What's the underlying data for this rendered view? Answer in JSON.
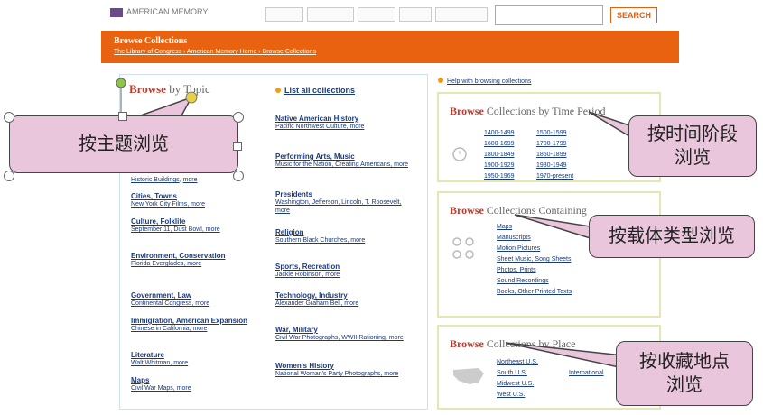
{
  "header": {
    "logo_text": "AMERICAN MEMORY",
    "search_label": "SEARCH"
  },
  "banner": {
    "title": "Browse Collections",
    "crumbs": "The Library of Congress › American Memory Home › Browse Collections"
  },
  "topic_panel": {
    "heading_bold": "Browse",
    "heading_rest": " by Topic",
    "list_all": "List all collections",
    "left_topics": [
      {
        "title": "Historic Buildings",
        "sub": "more"
      },
      {
        "title": "Cities, Towns",
        "sub": "New York City Films, more"
      },
      {
        "title": "Culture, Folklife",
        "sub": "September 11, Dust Bowl, more"
      },
      {
        "title": "Environment, Conservation",
        "sub": "Florida Everglades, more"
      },
      {
        "title": "Government, Law",
        "sub": "Continental Congress, more"
      },
      {
        "title": "Immigration, American Expansion",
        "sub": "Chinese in California, more"
      },
      {
        "title": "Literature",
        "sub": "Walt Whitman, more"
      },
      {
        "title": "Maps",
        "sub": "Civil War Maps, more"
      }
    ],
    "right_topics": [
      {
        "title": "Native American History",
        "sub": "Pacific Northwest Culture, more"
      },
      {
        "title": "Performing Arts, Music",
        "sub": "Music for the Nation, Creating Americans, more"
      },
      {
        "title": "Presidents",
        "sub": "Washington, Jefferson, Lincoln, T. Roosevelt, more"
      },
      {
        "title": "Religion",
        "sub": "Southern Black Churches, more"
      },
      {
        "title": "Sports, Recreation",
        "sub": "Jackie Robinson, more"
      },
      {
        "title": "Technology, Industry",
        "sub": "Alexander Graham Bell, more"
      },
      {
        "title": "War, Military",
        "sub": "Civil War Photographs, WWII Rationing, more"
      },
      {
        "title": "Women's History",
        "sub": "National Woman's Party Photographs, more"
      }
    ]
  },
  "right_column": {
    "help": "Help with browsing collections",
    "time": {
      "heading_bold": "Browse",
      "heading_rest": " Collections by Time Period",
      "periods": [
        "1400-1499",
        "1500-1599",
        "1600-1699",
        "1700-1799",
        "1800-1849",
        "1850-1899",
        "1900-1929",
        "1930-1949",
        "1950-1969",
        "1970-present"
      ]
    },
    "containing": {
      "heading_bold": "Browse",
      "heading_rest": " Collections Containing",
      "types": [
        "Maps",
        "Manuscripts",
        "Motion Pictures",
        "Sheet Music, Song Sheets",
        "Photos, Prints",
        "Sound Recordings",
        "Books, Other Printed Texts"
      ]
    },
    "place": {
      "heading_bold": "Browse",
      "heading_rest": " Collections by Place",
      "places": [
        "Northeast U.S.",
        "South U.S.",
        "Midwest U.S.",
        "West U.S."
      ],
      "international": "International"
    }
  },
  "callouts": {
    "topic": "按主题浏览",
    "time": "按时间阶段\n浏览",
    "media": "按载体类型浏览",
    "place": "按收藏地点\n浏览"
  }
}
